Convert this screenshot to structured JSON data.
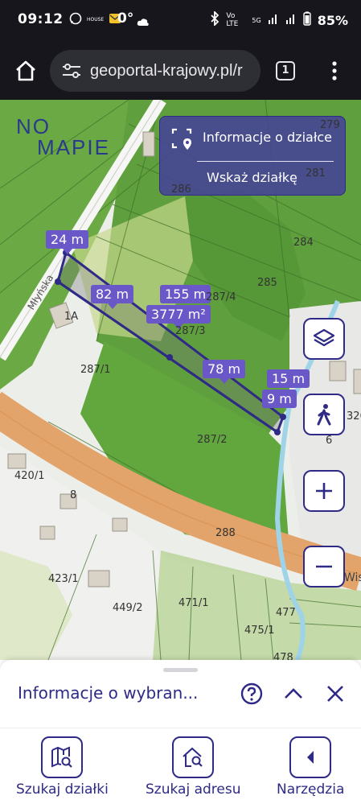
{
  "status_bar": {
    "time": "09:12",
    "notification_label": "HOUSE",
    "temperature": "0°",
    "network_label": "Vo LTE",
    "signal_label": "5G",
    "battery": "85%"
  },
  "browser": {
    "url": "geoportal-krajowy.pl/r",
    "tab_count": "1"
  },
  "map": {
    "logo_line1": "NO",
    "logo_line2": "MAPIE",
    "info_panel": {
      "title": "Informacje o działce",
      "link": "Wskaż działkę"
    },
    "measurements": {
      "side_24": "24 m",
      "side_82": "82 m",
      "side_155": "155 m",
      "area": "3777 m²",
      "side_78": "78 m",
      "side_15": "15 m",
      "side_9": "9 m"
    },
    "parcels": [
      "279",
      "281",
      "286",
      "284",
      "285",
      "287/4",
      "287/3",
      "287/1",
      "287/2",
      "1A",
      "420/1",
      "8",
      "423/1",
      "449/2",
      "471/1",
      "477",
      "475/1",
      "478",
      "288",
      "326",
      "6"
    ],
    "street_labels": [
      "Młyńska",
      "Wis"
    ],
    "controls": [
      "layers-icon",
      "walk-icon",
      "zoom-in-icon",
      "zoom-out-icon"
    ]
  },
  "drawer": {
    "title": "Informacje o wybran..."
  },
  "bottom_nav": [
    {
      "label": "Szukaj działki",
      "icon": "map-search-icon"
    },
    {
      "label": "Szukaj adresu",
      "icon": "home-search-icon"
    },
    {
      "label": "Narzędzia",
      "icon": "tools-icon"
    }
  ],
  "colors": {
    "accent": "#2e2a86",
    "measure": "#6a57c8",
    "forest": "#5aa03a",
    "road": "#e2a46a"
  }
}
